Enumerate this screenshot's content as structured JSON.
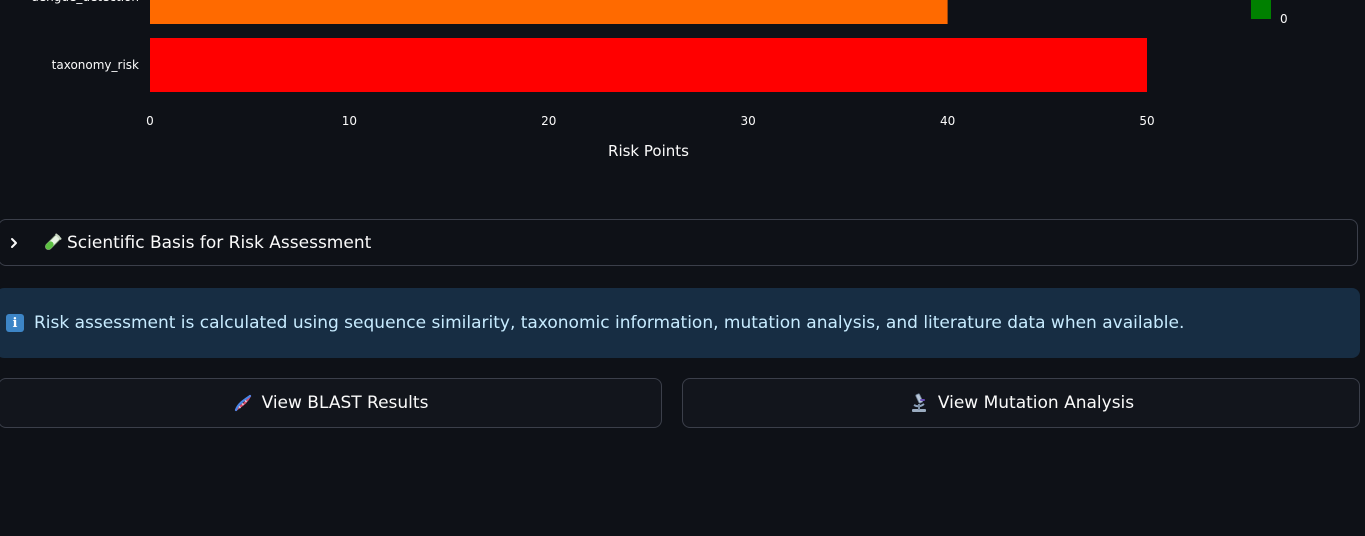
{
  "chart_data": {
    "type": "bar",
    "orientation": "horizontal",
    "categories": [
      "dengue_detection",
      "taxonomy_risk"
    ],
    "values": [
      40,
      50
    ],
    "colors": [
      "#ff6a00",
      "#ff0000"
    ],
    "xlabel": "Risk Points",
    "xlim": [
      0,
      50
    ],
    "xticks": [
      0,
      10,
      20,
      30,
      40,
      50
    ],
    "grid": false,
    "colorbar": {
      "bottom_label": "0",
      "color": "#008000"
    }
  },
  "expander": {
    "label": "Scientific Basis for Risk Assessment",
    "icon": "test-tube-icon",
    "expanded": false
  },
  "info": {
    "icon": "info-icon",
    "icon_glyph": "i",
    "text": "Risk assessment is calculated using sequence similarity, taxonomic information, mutation analysis, and literature data when available."
  },
  "buttons": {
    "blast": {
      "label": "View BLAST Results",
      "icon": "dna-icon"
    },
    "mutation": {
      "label": "View Mutation Analysis",
      "icon": "microscope-icon"
    }
  }
}
